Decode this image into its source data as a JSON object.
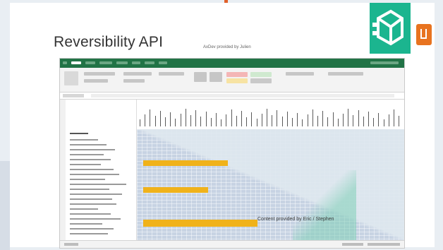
{
  "slide": {
    "title": "Reversibility API",
    "subtitle": "AxDev provided by Julien",
    "overlay_text": "Content provided by Eric / Stephen"
  },
  "colors": {
    "excel_green": "#217346",
    "gantt_bar": "#f0b21a",
    "grid_blue": "#c7d3e3",
    "logo_tile": "#1bb58f",
    "office_orange": "#e8731f"
  },
  "icons": [
    "logo-tile-icon",
    "office-add-in-icon"
  ],
  "window": {
    "app": "Excel"
  }
}
